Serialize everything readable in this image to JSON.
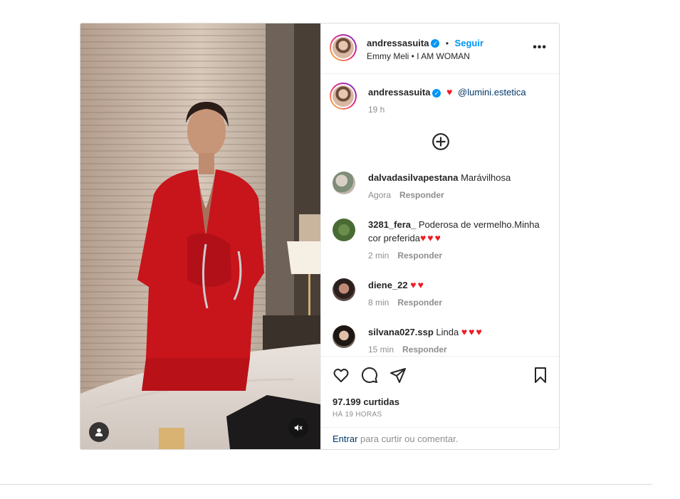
{
  "post": {
    "author": "andressasuita",
    "follow_label": "Seguir",
    "separator": "•",
    "audio": "Emmy Meli • I AM WOMAN",
    "more_label": "•••"
  },
  "caption": {
    "author": "andressasuita",
    "heart": "♥",
    "mention": "@lumini.estetica",
    "time": "19 h"
  },
  "comments": [
    {
      "user": "dalvadasilvapestana",
      "text": "Marávilhosa",
      "time": "Agora",
      "reply": "Responder"
    },
    {
      "user": "3281_fera_",
      "text": "Poderosa de vermelho.Minha cor preferida",
      "hearts": "♥♥♥",
      "time": "2 min",
      "reply": "Responder"
    },
    {
      "user": "diene_22",
      "text": "",
      "hearts": "♥♥",
      "time": "8 min",
      "reply": "Responder"
    },
    {
      "user": "silvana027.ssp",
      "text": "Linda",
      "hearts": "♥♥♥",
      "time": "15 min",
      "reply": "Responder"
    }
  ],
  "likes": "97.199 curtidas",
  "posted_ago": "HÁ 19 HORAS",
  "login": {
    "link": "Entrar",
    "rest": " para curtir ou comentar."
  },
  "colors": {
    "accent": "#0095f6",
    "heart": "#ed1c24",
    "suit": "#c8141b"
  },
  "icons": [
    "more-icon",
    "add-comment-icon",
    "heart-icon",
    "comment-icon",
    "share-icon",
    "bookmark-icon",
    "user-tag-icon",
    "muted-icon"
  ]
}
